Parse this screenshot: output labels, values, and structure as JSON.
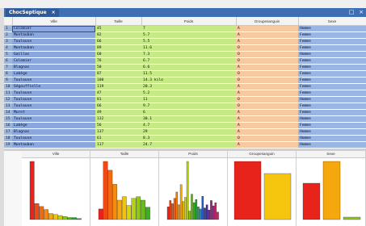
{
  "window": {
    "tab_title": "ChocSeptique",
    "tab_close": "×",
    "maximize": "□",
    "close": "×"
  },
  "columns": [
    "",
    "Ville",
    "Taille",
    "Poids",
    "Groupesanguin",
    "Sexe"
  ],
  "rows": [
    [
      "1",
      "Colomier",
      "45",
      "7",
      "A",
      "Homme"
    ],
    [
      "2",
      "Montauban",
      "82",
      "5.7",
      "A",
      "Femme"
    ],
    [
      "3",
      "Toulouse",
      "66",
      "5.5",
      "A",
      "Femme"
    ],
    [
      "4",
      "Montauban",
      "89",
      "11.6",
      "O",
      "Femme"
    ],
    [
      "5",
      "Gaillac",
      "60",
      "7.3",
      "O",
      "Homme"
    ],
    [
      "6",
      "Colomier",
      "76",
      "6.7",
      "O",
      "Femme"
    ],
    [
      "7",
      "Blagnac",
      "50",
      "6.6",
      "A",
      "Femme"
    ],
    [
      "8",
      "Labège",
      "87",
      "11.5",
      "O",
      "Femme"
    ],
    [
      "9",
      "Toulouse",
      "100",
      "14.3 kilo",
      "O",
      "Femme"
    ],
    [
      "10",
      "Ségouffielle",
      "119",
      "20.3",
      "A",
      "Femme"
    ],
    [
      "11",
      "Toulouse",
      "47",
      "5.2",
      "A",
      "Femme"
    ],
    [
      "12",
      "Toulouse",
      "81",
      "11",
      "O",
      "Homme"
    ],
    [
      "13",
      "Toulouse",
      "66",
      "9.7",
      "O",
      "Femme"
    ],
    [
      "14",
      "Muret",
      "49",
      "6",
      "A",
      "Femme"
    ],
    [
      "15",
      "Toulouse",
      "132",
      "30.1",
      "A",
      "Homme"
    ],
    [
      "16",
      "Labège",
      "56",
      "4.7",
      "A",
      "Femme"
    ],
    [
      "17",
      "Blagnac",
      "137",
      "29",
      "A",
      "Homme"
    ],
    [
      "18",
      "Toulouse",
      "61",
      "8.3",
      "O",
      "Homme"
    ],
    [
      "19",
      "Montauban",
      "117",
      "24.7",
      "A",
      "Homme"
    ]
  ],
  "chart_headers": [
    "Ville",
    "Taille",
    "Poids",
    "Groupesanguin",
    "Sexe"
  ],
  "chart_data": [
    {
      "type": "bar",
      "title": "Ville",
      "values": [
        58,
        16,
        13,
        10,
        6,
        5,
        4,
        3,
        2,
        2,
        1
      ],
      "colors": [
        "#e8231b",
        "#ee4a16",
        "#f06a12",
        "#f48a10",
        "#f5a80e",
        "#f0c30d",
        "#c8cf10",
        "#8fc813",
        "#4fb61b",
        "#2aa43a",
        "#2a7fd0"
      ]
    },
    {
      "type": "bar",
      "title": "Taille",
      "values": [
        6,
        33,
        28,
        20,
        11,
        13,
        8,
        12,
        13,
        11,
        7
      ],
      "colors": [
        "#e8231b",
        "#ee4a16",
        "#f06a12",
        "#f48a10",
        "#f5a80e",
        "#f0c30d",
        "#d8d50f",
        "#b4d212",
        "#8fc813",
        "#69bd16",
        "#3cb01e"
      ]
    },
    {
      "type": "bar",
      "title": "Poids",
      "values": [
        12,
        18,
        15,
        20,
        26,
        14,
        33,
        17,
        21,
        55,
        8,
        24,
        16,
        19,
        12,
        10,
        22,
        11,
        14,
        9,
        18,
        13,
        16,
        7
      ],
      "colors": [
        "#e8231b",
        "#ee3a17",
        "#f05014",
        "#f26612",
        "#f47c10",
        "#f5920e",
        "#f5a80e",
        "#f0c30d",
        "#d8d50f",
        "#b4d212",
        "#8fc813",
        "#69bd16",
        "#3cb01e",
        "#2aa43a",
        "#249a70",
        "#2a7fd0",
        "#2b5bbd",
        "#3140a8",
        "#4a2f9a",
        "#6a2a8e",
        "#8a2782",
        "#a62676",
        "#c0256a",
        "#d0245e"
      ]
    },
    {
      "type": "bar",
      "title": "Groupesanguin",
      "values": [
        72,
        57
      ],
      "colors": [
        "#e8231b",
        "#f5c60d"
      ]
    },
    {
      "type": "bar",
      "title": "Sexe",
      "values": [
        45,
        72,
        3
      ],
      "colors": [
        "#e8231b",
        "#f5a80e",
        "#8fc813"
      ]
    }
  ]
}
